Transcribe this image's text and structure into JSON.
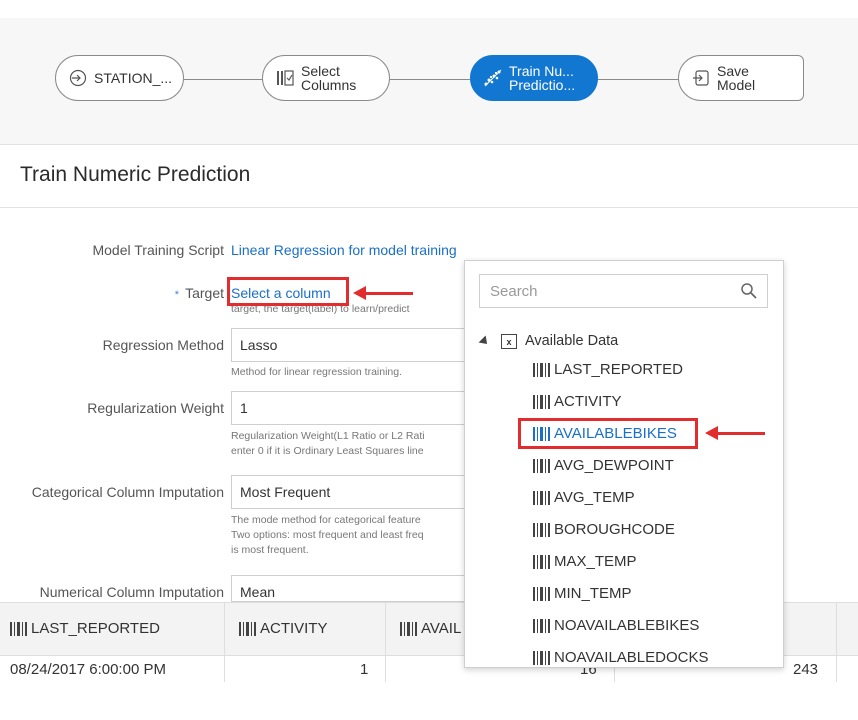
{
  "pipeline": {
    "nodes": [
      {
        "label1": "STATION_...",
        "label2": "",
        "icon": "arrow-circle-icon"
      },
      {
        "label1": "Select",
        "label2": "Columns",
        "icon": "columns-icon"
      },
      {
        "label1": "Train Nu...",
        "label2": "Predictio...",
        "icon": "scatter-icon"
      },
      {
        "label1": "Save",
        "label2": "Model",
        "icon": "save-icon"
      }
    ]
  },
  "page_title": "Train Numeric Prediction",
  "form": {
    "script_label": "Model Training Script",
    "script_value": "Linear Regression for model training",
    "target_required": "*",
    "target_label": "Target",
    "target_value": "Select a column",
    "target_hint": "target, the target(label) to learn/predict",
    "method_label": "Regression Method",
    "method_value": "Lasso",
    "method_hint": "Method for linear regression training.",
    "weight_label": "Regularization Weight",
    "weight_value": "1",
    "weight_hint1": "Regularization Weight(L1 Ratio or L2 Rati",
    "weight_hint2": "enter 0 if it is Ordinary Least Squares line",
    "cat_label": "Categorical Column Imputation",
    "cat_value": "Most Frequent",
    "cat_hint1": "The mode method for categorical feature",
    "cat_hint2": "Two options: most frequent and least freq",
    "cat_hint3": "is most frequent.",
    "num_label": "Numerical Column Imputation",
    "num_value": "Mean"
  },
  "dropdown": {
    "search_placeholder": "Search",
    "root_label": "Available Data",
    "items": [
      "LAST_REPORTED",
      "ACTIVITY",
      "AVAILABLEBIKES",
      "AVG_DEWPOINT",
      "AVG_TEMP",
      "BOROUGHCODE",
      "MAX_TEMP",
      "MIN_TEMP",
      "NOAVAILABLEBIKES",
      "NOAVAILABLEDOCKS"
    ],
    "selected": "AVAILABLEBIKES"
  },
  "table": {
    "headers": [
      "LAST_REPORTED",
      "ACTIVITY",
      "AVAIL"
    ],
    "row": [
      "08/24/2017 6:00:00 PM",
      "1",
      "16",
      "243"
    ]
  },
  "colors": {
    "accent": "#1177d1",
    "annotation": "#e12d2d",
    "link": "#1a6fc9"
  }
}
